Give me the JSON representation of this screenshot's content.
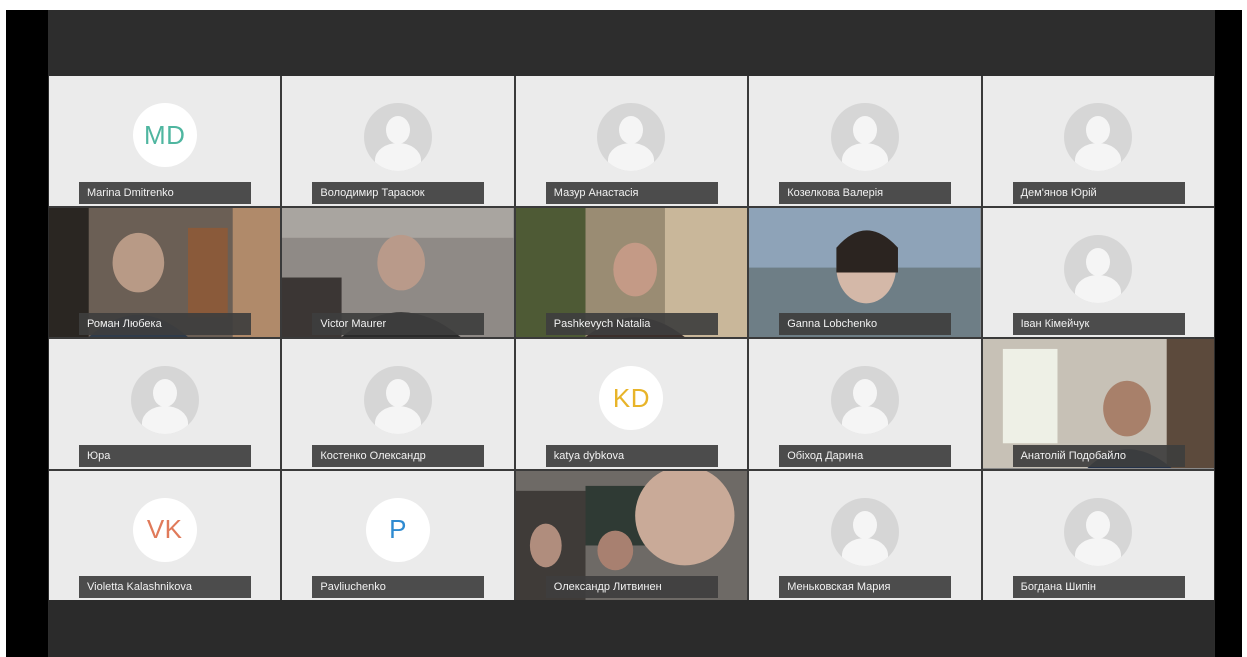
{
  "participants": [
    {
      "name": "Marina Dmitrenko",
      "kind": "initials",
      "initials": "MD",
      "initials_color": "#4fb6a0"
    },
    {
      "name": "Володимир Тарасюк",
      "kind": "placeholder"
    },
    {
      "name": "Мазур Анастасія",
      "kind": "placeholder"
    },
    {
      "name": "Козелкова Валерія",
      "kind": "placeholder"
    },
    {
      "name": "Дем'янов Юрій",
      "kind": "placeholder"
    },
    {
      "name": "Роман Любека",
      "kind": "video"
    },
    {
      "name": "Victor Maurer",
      "kind": "video"
    },
    {
      "name": "Pashkevych Natalia",
      "kind": "video"
    },
    {
      "name": "Ganna Lobchenko",
      "kind": "video"
    },
    {
      "name": "Іван Кімейчук",
      "kind": "placeholder"
    },
    {
      "name": "Юра",
      "kind": "placeholder"
    },
    {
      "name": "Костенко Олександр",
      "kind": "placeholder"
    },
    {
      "name": "katya dybkova",
      "kind": "initials",
      "initials": "KD",
      "initials_color": "#e8b429"
    },
    {
      "name": "Обіход Дарина",
      "kind": "placeholder"
    },
    {
      "name": "Анатолій Подобайло",
      "kind": "video"
    },
    {
      "name": "Violetta Kalashnikova",
      "kind": "initials",
      "initials": "VK",
      "initials_color": "#e07a5a"
    },
    {
      "name": "Pavliuchenko",
      "kind": "initials",
      "initials": "P",
      "initials_color": "#2f8bd1"
    },
    {
      "name": "Олександр Литвинен",
      "kind": "video"
    },
    {
      "name": "Меньковская Мария",
      "kind": "placeholder"
    },
    {
      "name": "Богдана Шипін",
      "kind": "placeholder"
    }
  ]
}
